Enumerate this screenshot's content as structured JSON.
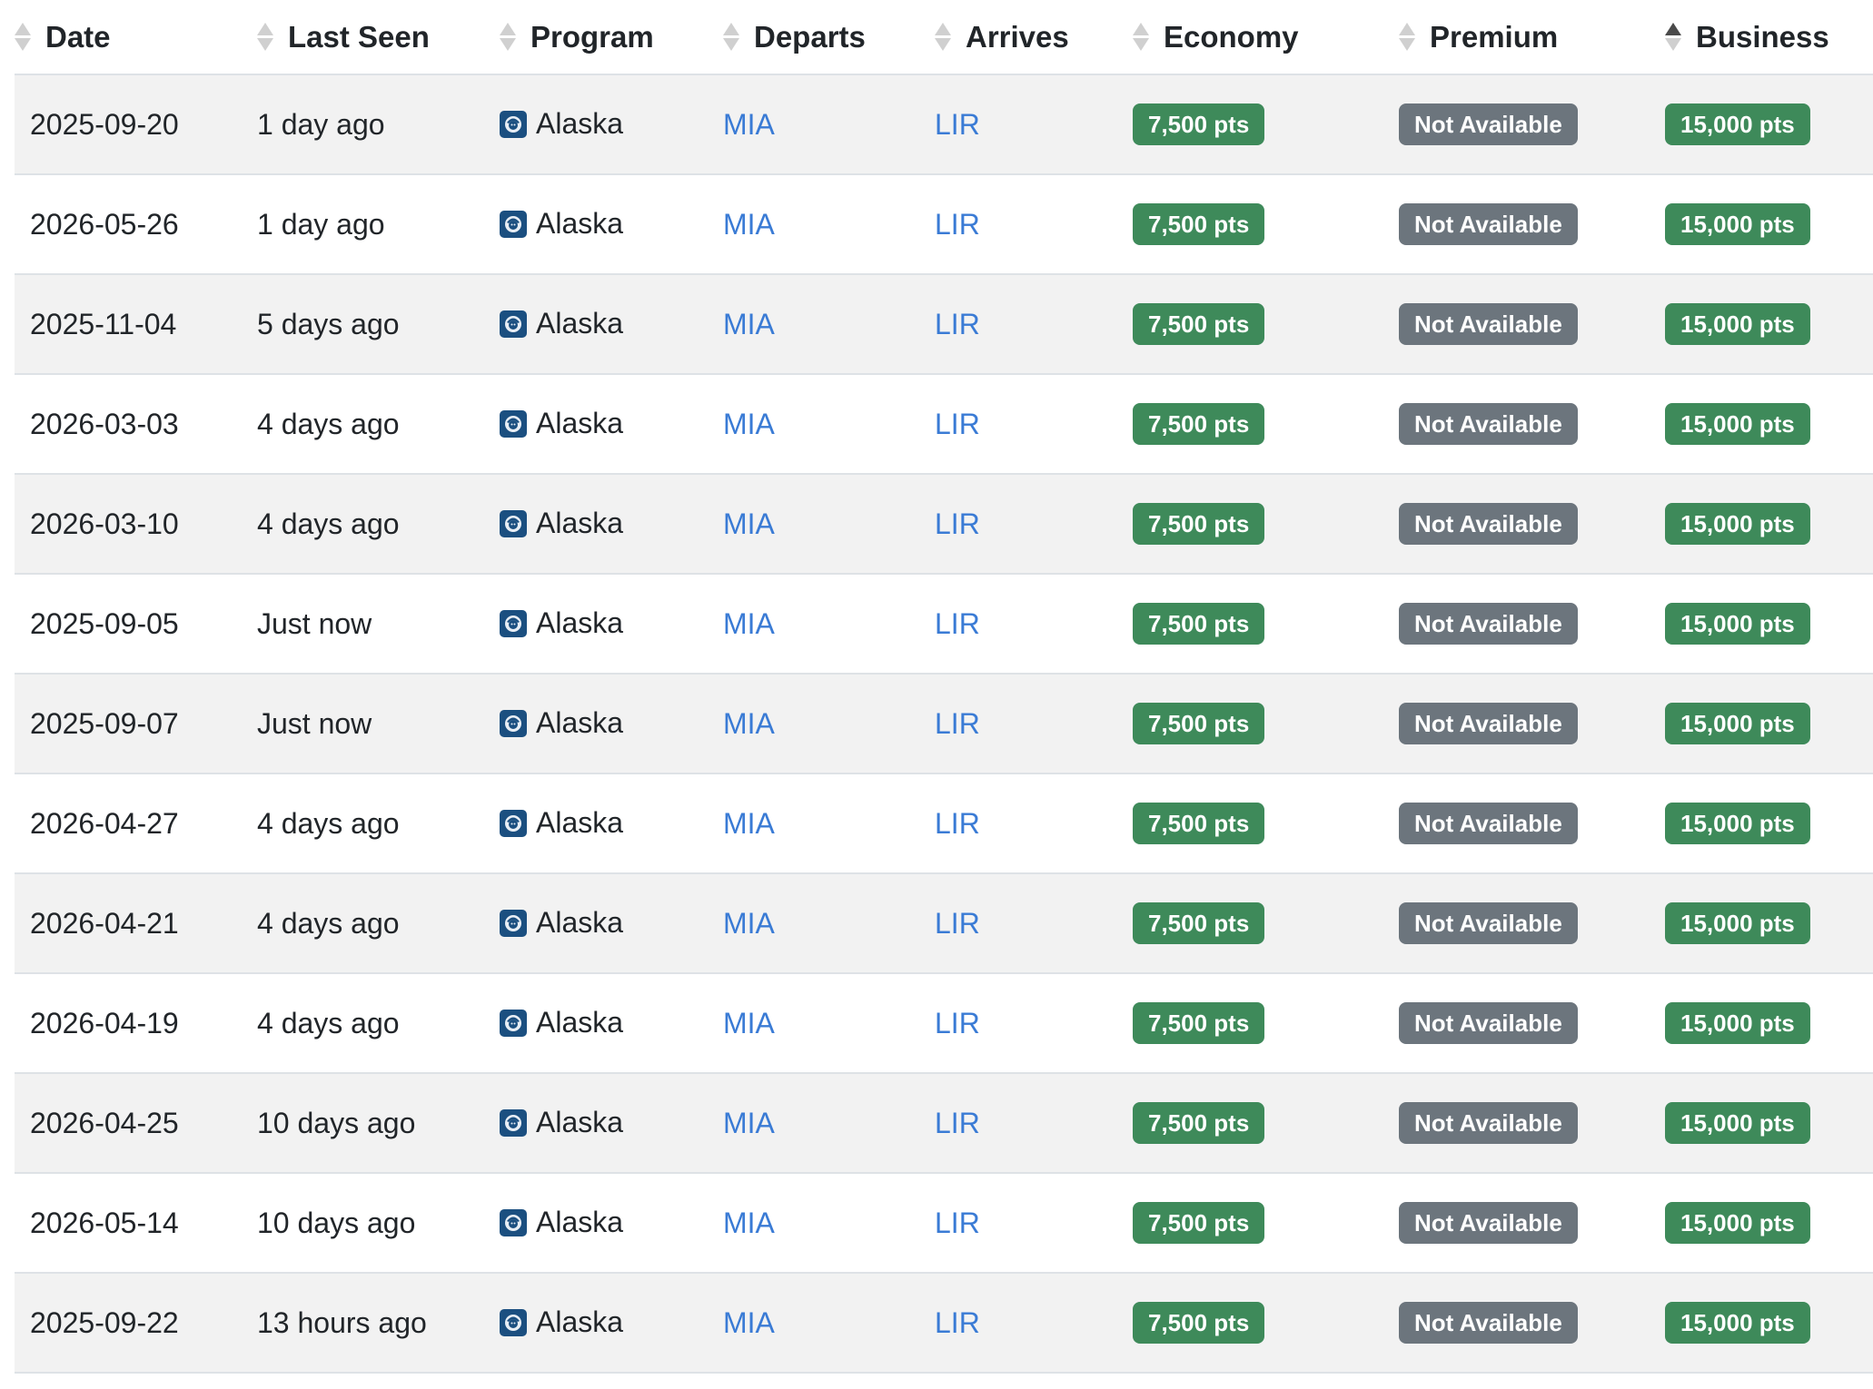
{
  "table": {
    "columns": [
      {
        "label": "Date",
        "sort": "none"
      },
      {
        "label": "Last Seen",
        "sort": "none"
      },
      {
        "label": "Program",
        "sort": "none"
      },
      {
        "label": "Departs",
        "sort": "none"
      },
      {
        "label": "Arrives",
        "sort": "none"
      },
      {
        "label": "Economy",
        "sort": "none"
      },
      {
        "label": "Premium",
        "sort": "none"
      },
      {
        "label": "Business",
        "sort": "ascending"
      }
    ],
    "rows": [
      {
        "date": "2025-09-20",
        "last_seen": "1 day ago",
        "program": "Alaska",
        "departs": "MIA",
        "arrives": "LIR",
        "economy": "7,500 pts",
        "premium": "Not Available",
        "business": "15,000 pts"
      },
      {
        "date": "2026-05-26",
        "last_seen": "1 day ago",
        "program": "Alaska",
        "departs": "MIA",
        "arrives": "LIR",
        "economy": "7,500 pts",
        "premium": "Not Available",
        "business": "15,000 pts"
      },
      {
        "date": "2025-11-04",
        "last_seen": "5 days ago",
        "program": "Alaska",
        "departs": "MIA",
        "arrives": "LIR",
        "economy": "7,500 pts",
        "premium": "Not Available",
        "business": "15,000 pts"
      },
      {
        "date": "2026-03-03",
        "last_seen": "4 days ago",
        "program": "Alaska",
        "departs": "MIA",
        "arrives": "LIR",
        "economy": "7,500 pts",
        "premium": "Not Available",
        "business": "15,000 pts"
      },
      {
        "date": "2026-03-10",
        "last_seen": "4 days ago",
        "program": "Alaska",
        "departs": "MIA",
        "arrives": "LIR",
        "economy": "7,500 pts",
        "premium": "Not Available",
        "business": "15,000 pts"
      },
      {
        "date": "2025-09-05",
        "last_seen": "Just now",
        "program": "Alaska",
        "departs": "MIA",
        "arrives": "LIR",
        "economy": "7,500 pts",
        "premium": "Not Available",
        "business": "15,000 pts"
      },
      {
        "date": "2025-09-07",
        "last_seen": "Just now",
        "program": "Alaska",
        "departs": "MIA",
        "arrives": "LIR",
        "economy": "7,500 pts",
        "premium": "Not Available",
        "business": "15,000 pts"
      },
      {
        "date": "2026-04-27",
        "last_seen": "4 days ago",
        "program": "Alaska",
        "departs": "MIA",
        "arrives": "LIR",
        "economy": "7,500 pts",
        "premium": "Not Available",
        "business": "15,000 pts"
      },
      {
        "date": "2026-04-21",
        "last_seen": "4 days ago",
        "program": "Alaska",
        "departs": "MIA",
        "arrives": "LIR",
        "economy": "7,500 pts",
        "premium": "Not Available",
        "business": "15,000 pts"
      },
      {
        "date": "2026-04-19",
        "last_seen": "4 days ago",
        "program": "Alaska",
        "departs": "MIA",
        "arrives": "LIR",
        "economy": "7,500 pts",
        "premium": "Not Available",
        "business": "15,000 pts"
      },
      {
        "date": "2026-04-25",
        "last_seen": "10 days ago",
        "program": "Alaska",
        "departs": "MIA",
        "arrives": "LIR",
        "economy": "7,500 pts",
        "premium": "Not Available",
        "business": "15,000 pts"
      },
      {
        "date": "2026-05-14",
        "last_seen": "10 days ago",
        "program": "Alaska",
        "departs": "MIA",
        "arrives": "LIR",
        "economy": "7,500 pts",
        "premium": "Not Available",
        "business": "15,000 pts"
      },
      {
        "date": "2025-09-22",
        "last_seen": "13 hours ago",
        "program": "Alaska",
        "departs": "MIA",
        "arrives": "LIR",
        "economy": "7,500 pts",
        "premium": "Not Available",
        "business": "15,000 pts"
      }
    ]
  },
  "program_icon": "alaska-airlines-logo-icon",
  "colors": {
    "available_badge": "#3e8a5a",
    "unavailable_badge": "#6c757d",
    "link": "#3a7bd5",
    "stripe": "#f2f2f2"
  }
}
